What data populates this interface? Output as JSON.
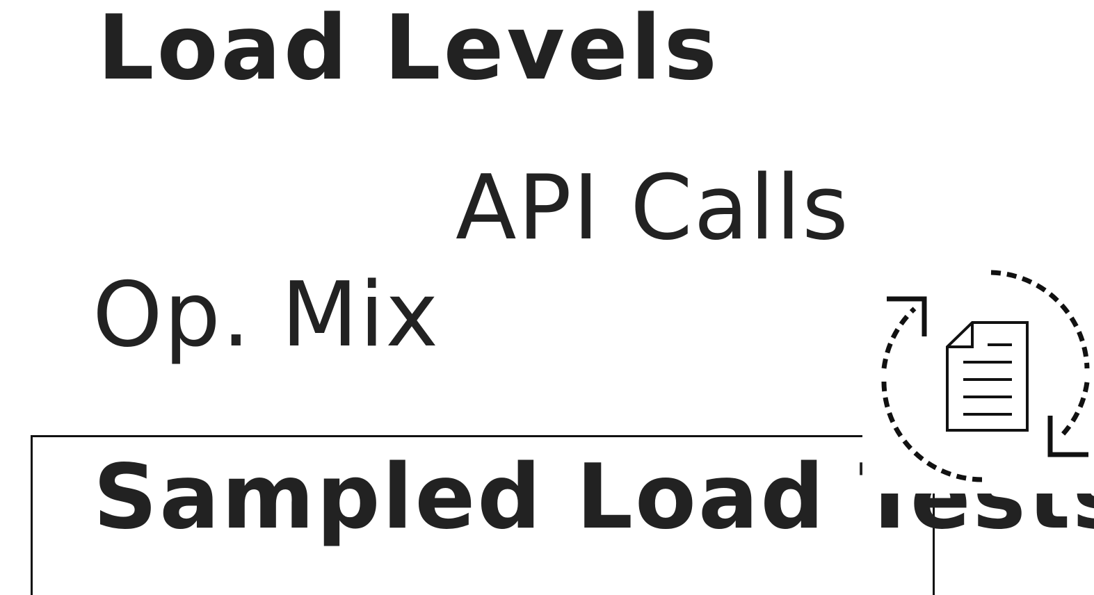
{
  "labels": {
    "load_levels": "Load Levels",
    "api_calls": "API Calls",
    "op_mix": "Op. Mix",
    "sampled_load_tests": "Sampled Load Tests"
  },
  "icons": {
    "cycle": "refresh-cycle-icon",
    "document": "document-icon"
  },
  "colors": {
    "text": "#222222",
    "line": "#111111",
    "background": "#ffffff"
  }
}
